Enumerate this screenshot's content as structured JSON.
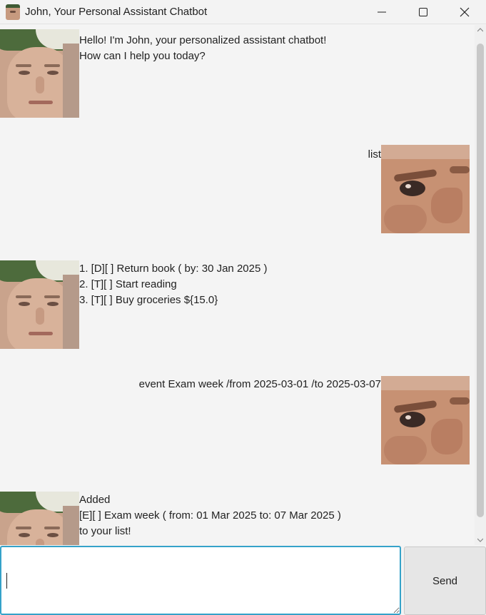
{
  "window": {
    "title": "John, Your Personal Assistant Chatbot",
    "app_icon": "bot-avatar-icon",
    "controls": [
      "minimize-icon",
      "maximize-icon",
      "close-icon"
    ]
  },
  "chat": {
    "messages": [
      {
        "sender": "bot",
        "text": "Hello! I'm John, your personalized assistant chatbot!\nHow can I help you today?"
      },
      {
        "sender": "user",
        "text": "list"
      },
      {
        "sender": "bot",
        "text": "1. [D][ ] Return book ( by: 30 Jan 2025 )\n2. [T][ ] Start reading\n3. [T][ ] Buy groceries ${15.0}"
      },
      {
        "sender": "user",
        "text": "event Exam week /from 2025-03-01 /to 2025-03-07"
      },
      {
        "sender": "bot",
        "text": "Added\n[E][ ] Exam week ( from: 01 Mar 2025 to: 07 Mar 2025 )\nto your list!"
      }
    ]
  },
  "input": {
    "value": "",
    "placeholder": ""
  },
  "send_button": {
    "label": "Send"
  },
  "colors": {
    "input_focus_border": "#35a2c9",
    "background": "#f4f4f4"
  }
}
